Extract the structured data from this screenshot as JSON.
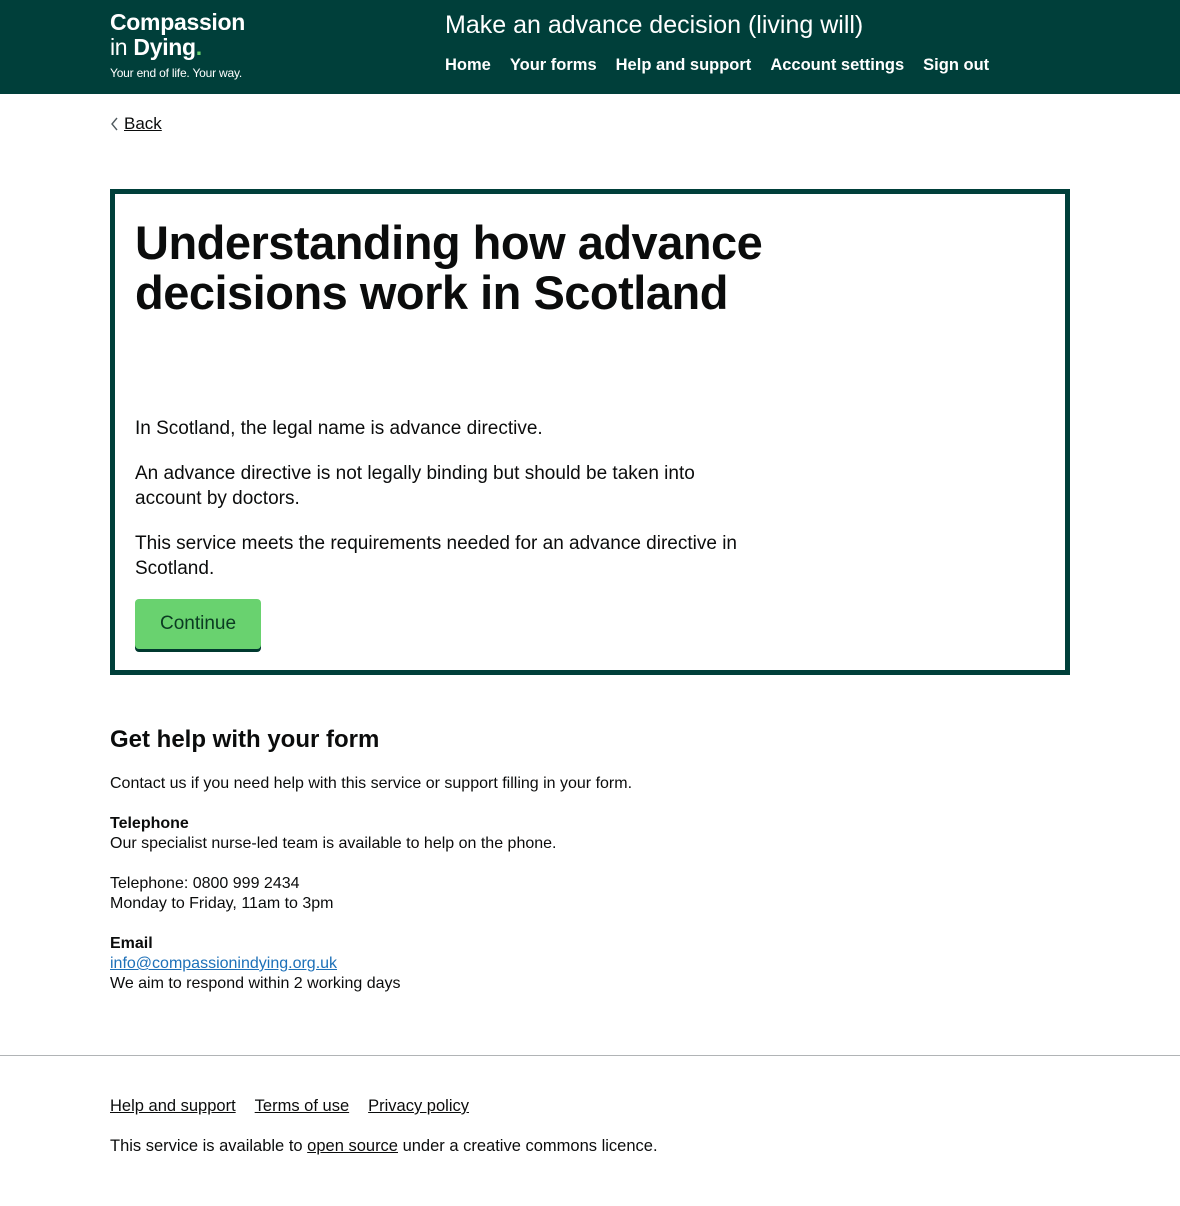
{
  "header": {
    "logo": {
      "line1": "Compassion",
      "line2_a": "in",
      "line2_b": "Dying",
      "dot": ".",
      "tagline": "Your end of life. Your way."
    },
    "service_name": "Make an advance decision (living will)",
    "nav": [
      "Home",
      "Your forms",
      "Help and support",
      "Account settings",
      "Sign out"
    ]
  },
  "back_link": "Back",
  "panel": {
    "heading": "Understanding how advance decisions work in Scotland",
    "paragraphs": [
      "In Scotland, the legal name is advance directive.",
      "An advance directive is not legally binding but should be taken into account by doctors.",
      "This service meets the requirements needed for an advance directive in Scotland."
    ],
    "continue_label": "Continue"
  },
  "help": {
    "title": "Get help with your form",
    "intro": "Contact us if you need help with this service or support filling in your form.",
    "telephone_heading": "Telephone",
    "telephone_desc": "Our specialist nurse-led team is available to help on the phone.",
    "telephone_number": "Telephone: 0800 999 2434",
    "telephone_hours": "Monday to Friday, 11am to 3pm",
    "email_heading": "Email",
    "email_address": "info@compassionindying.org.uk",
    "email_response": "We aim to respond within 2 working days"
  },
  "footer": {
    "links": [
      "Help and support",
      "Terms of use",
      "Privacy policy"
    ],
    "licence_before": "This service is available to ",
    "licence_link": "open source",
    "licence_after": " under a creative commons licence."
  },
  "colors": {
    "brand_dark_green": "#003f3a",
    "button_green": "#69d26f",
    "link_blue": "#1d70b8"
  }
}
